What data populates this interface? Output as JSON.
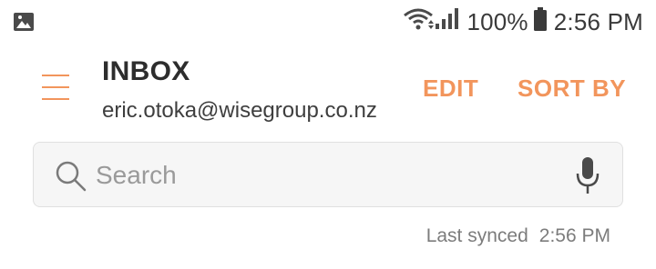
{
  "status_bar": {
    "left_icon": "image-icon",
    "wifi_icon": "wifi-icon",
    "signal_icon": "signal-icon",
    "battery_percent": "100%",
    "battery_icon": "battery-icon",
    "time": "2:56 PM"
  },
  "header": {
    "menu_icon": "hamburger-menu-icon",
    "title": "INBOX",
    "account": "eric.otoka@wisegroup.co.nz",
    "actions": {
      "edit_label": "EDIT",
      "sort_label": "SORT BY"
    }
  },
  "search": {
    "placeholder": "Search",
    "value": "",
    "search_icon": "search-icon",
    "mic_icon": "microphone-icon"
  },
  "sync": {
    "label": "Last synced",
    "time": "2:56 PM"
  },
  "colors": {
    "accent": "#f2955c",
    "text_dark": "#2d2d2d",
    "text_muted": "#7c7c7c",
    "search_bg": "#f6f6f6"
  }
}
